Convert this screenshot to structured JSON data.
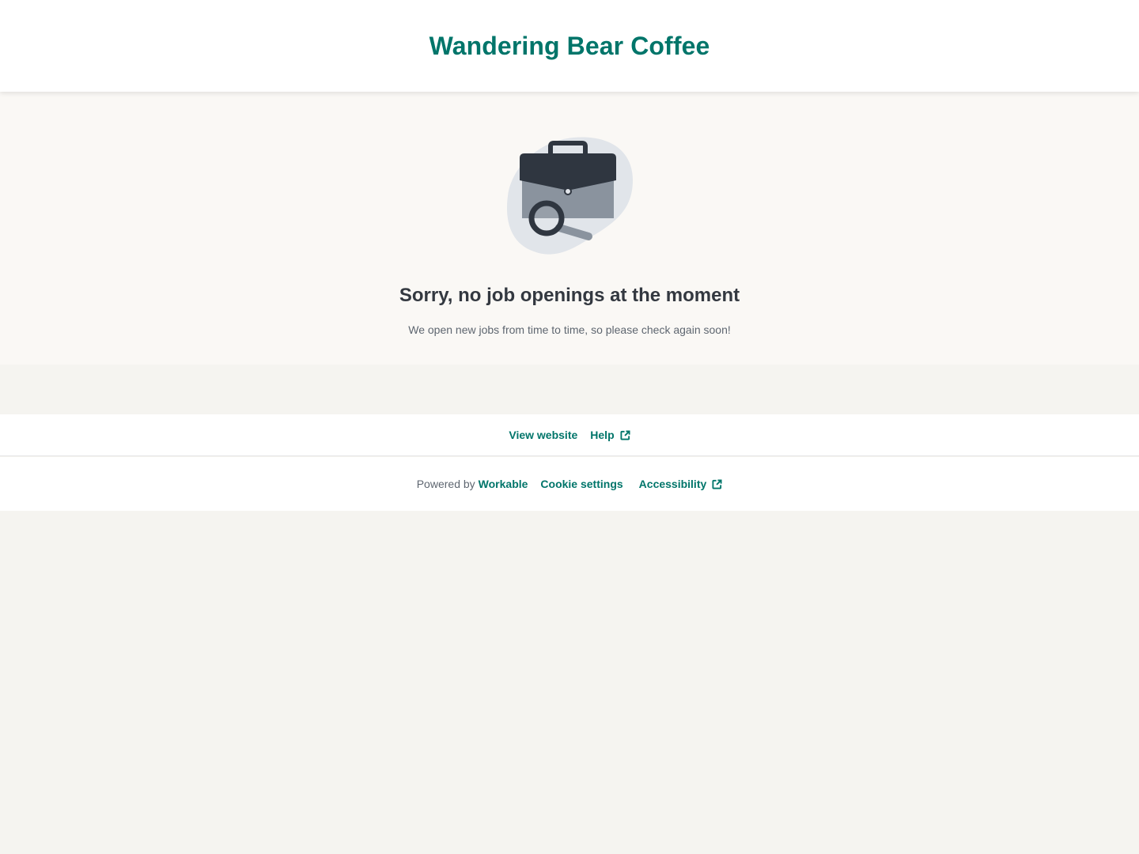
{
  "header": {
    "brand_name": "Wandering Bear Coffee",
    "brand_color": "#00756a"
  },
  "empty_state": {
    "illustration": "briefcase-search-icon",
    "headline": "Sorry, no job openings at the moment",
    "message": "We open new jobs from time to time, so please check again soon!"
  },
  "links": {
    "view_website": "View website",
    "help": "Help",
    "external_icon": "external-link-icon"
  },
  "footer": {
    "powered_by": "Powered by",
    "workable": "Workable",
    "cookie_settings": "Cookie settings",
    "accessibility": "Accessibility"
  },
  "colors": {
    "accent": "#00756a",
    "text_dark": "#333840",
    "text_muted": "#5e6670",
    "page_bg": "#f5f4f0",
    "main_bg": "#faf8f5"
  }
}
